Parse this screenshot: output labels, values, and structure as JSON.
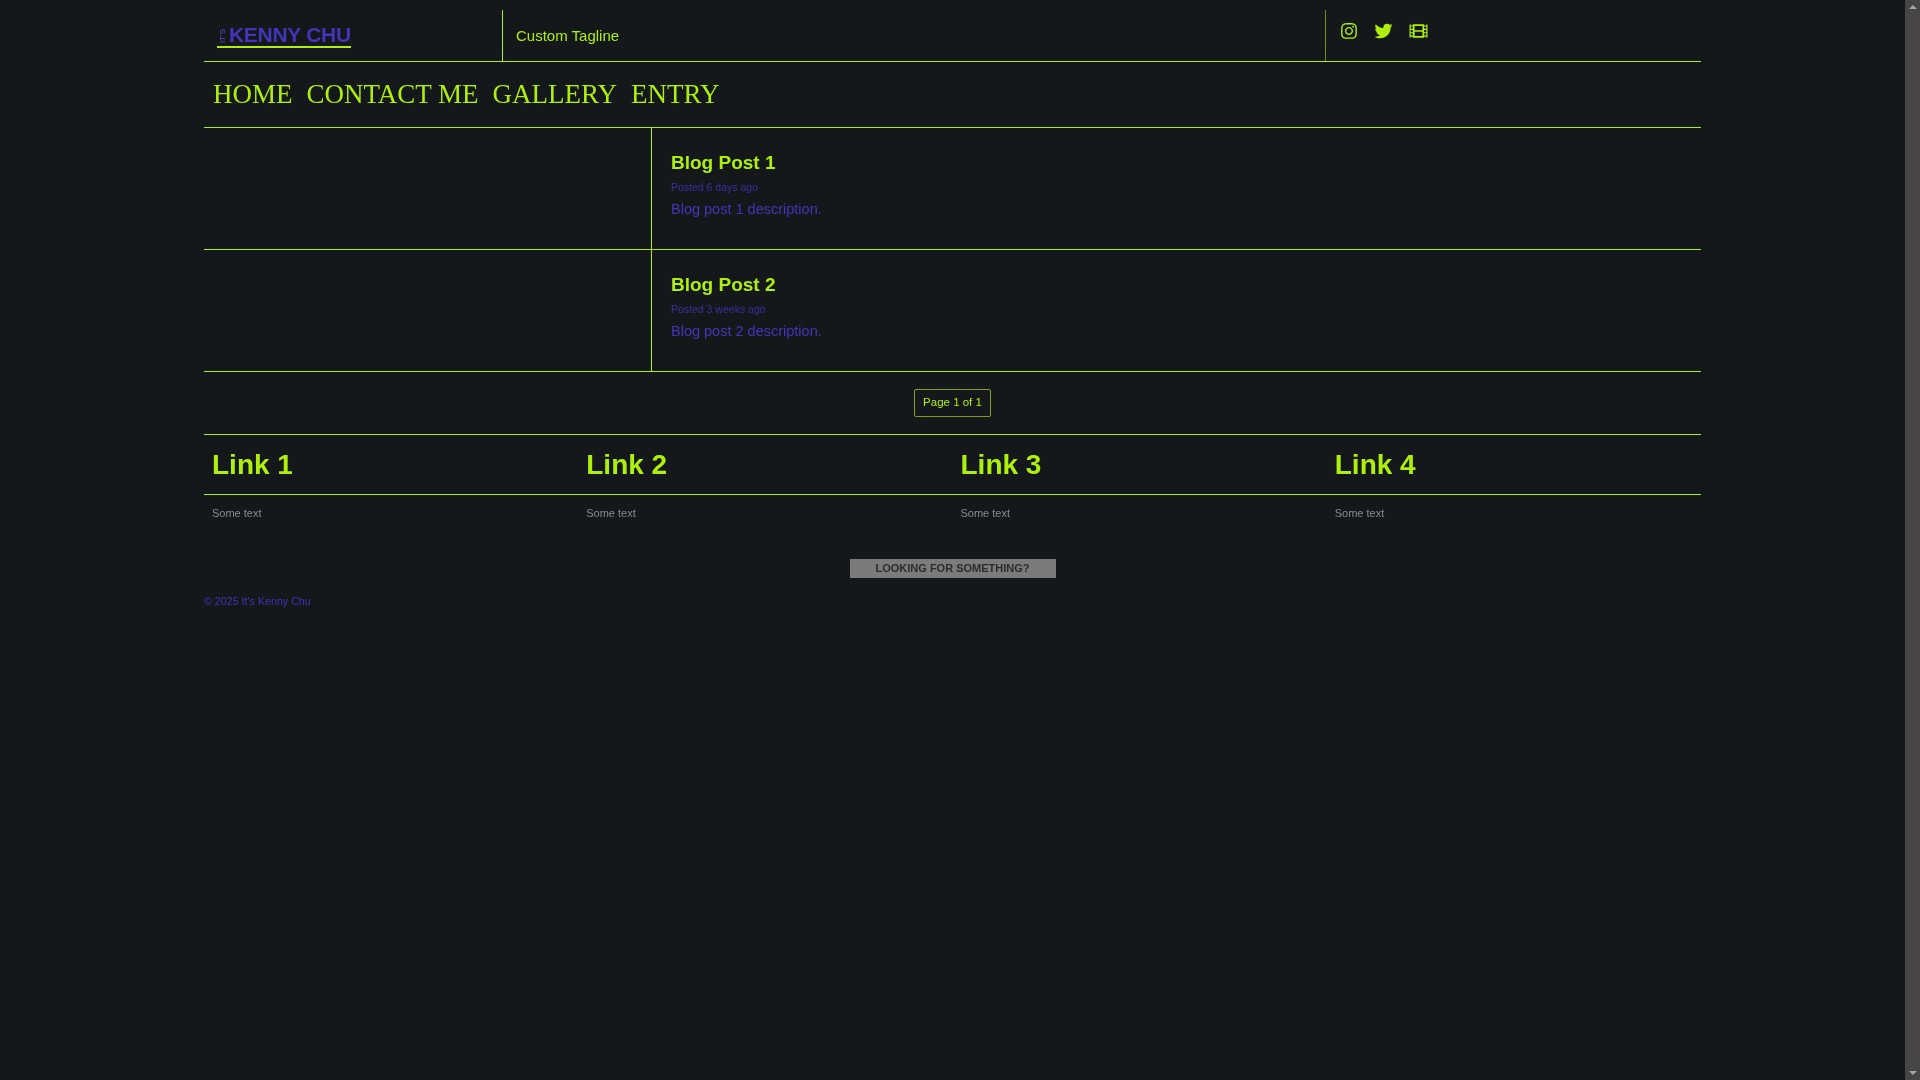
{
  "header": {
    "logo": {
      "prefix": "IT'S",
      "name": "KENNY CHU"
    },
    "tagline": "Custom Tagline"
  },
  "nav": {
    "items": [
      {
        "label": "HOME"
      },
      {
        "label": "CONTACT ME"
      },
      {
        "label": "GALLERY"
      },
      {
        "label": "ENTRY"
      }
    ]
  },
  "posts": [
    {
      "title": "Blog Post 1",
      "posted": "Posted 6 days ago",
      "description": "Blog post 1 description."
    },
    {
      "title": "Blog Post 2",
      "posted": "Posted 3 weeks ago",
      "description": "Blog post 2 description."
    }
  ],
  "pagination": {
    "label": "Page 1 of 1"
  },
  "footer_links": [
    {
      "title": "Link 1",
      "text": "Some text"
    },
    {
      "title": "Link 2",
      "text": "Some text"
    },
    {
      "title": "Link 3",
      "text": "Some text"
    },
    {
      "title": "Link 4",
      "text": "Some text"
    }
  ],
  "search_button": {
    "label": "LOOKING FOR SOMETHING?"
  },
  "copyright": "© 2025 It's Kenny Chu"
}
